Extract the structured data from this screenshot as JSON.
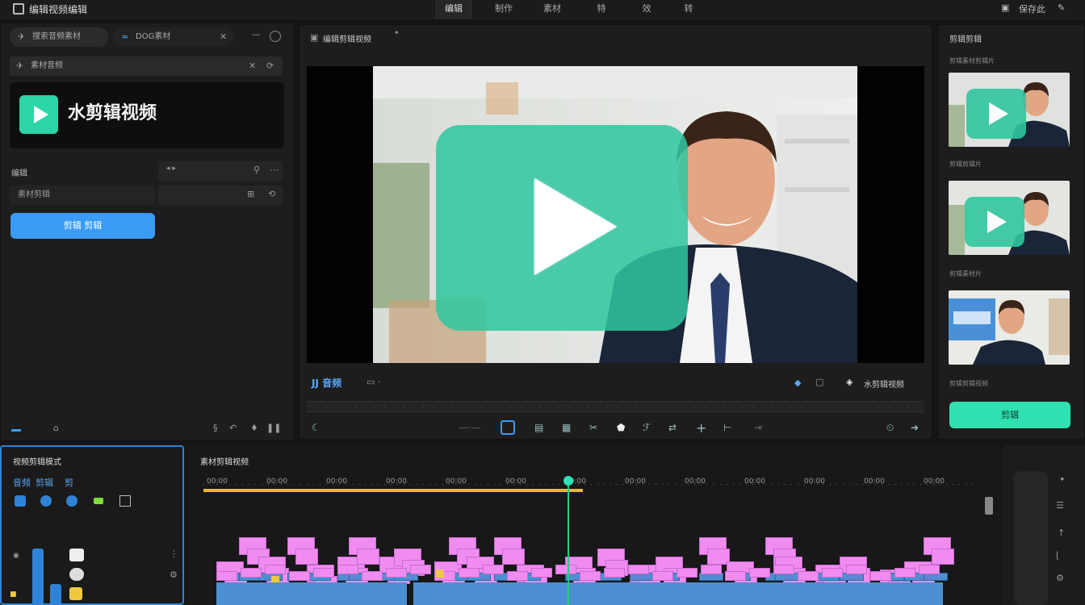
{
  "topbar": {
    "title": "编辑视频编辑",
    "tabs": [
      "编辑",
      "制作",
      "素材",
      "特",
      "效",
      "转"
    ],
    "right_label": "保存此"
  },
  "left": {
    "search1": "搜索音频素材",
    "search2": "DOG素材",
    "section_bar": "素材音频",
    "logo_text": "水剪辑视频",
    "prop_label": "编辑",
    "field_label": "素材剪辑",
    "btn_label": "剪辑 剪辑"
  },
  "preview": {
    "title": "编辑剪辑视频",
    "caption_left": "JJ 音频",
    "caption_right": "水剪辑视频"
  },
  "right": {
    "title": "剪辑剪辑",
    "label1": "剪辑素材剪辑片",
    "label2": "剪辑剪辑片",
    "label3": "剪辑素材片",
    "label4": "剪辑剪辑视频",
    "btn": "剪辑"
  },
  "bottom_left": {
    "title": "视频剪辑模式",
    "tags": [
      "音频",
      "剪辑",
      "剪"
    ]
  },
  "timeline": {
    "title": "素材剪辑视频",
    "ruler_labels": [
      "00:00",
      "00:00",
      "00:00",
      "00:00",
      "00:00",
      "00:00",
      "00:00",
      "00:00",
      "00:00",
      "00:00",
      "00:00",
      "00:00",
      "00:00"
    ]
  },
  "colors": {
    "accent_green": "#2fe0b0",
    "accent_blue": "#3a9cf5",
    "clip_pink": "#f08cf0",
    "clip_blue": "#4d8fd0",
    "playhead": "#22d07a",
    "ruler_yellow": "#e9b72a"
  }
}
